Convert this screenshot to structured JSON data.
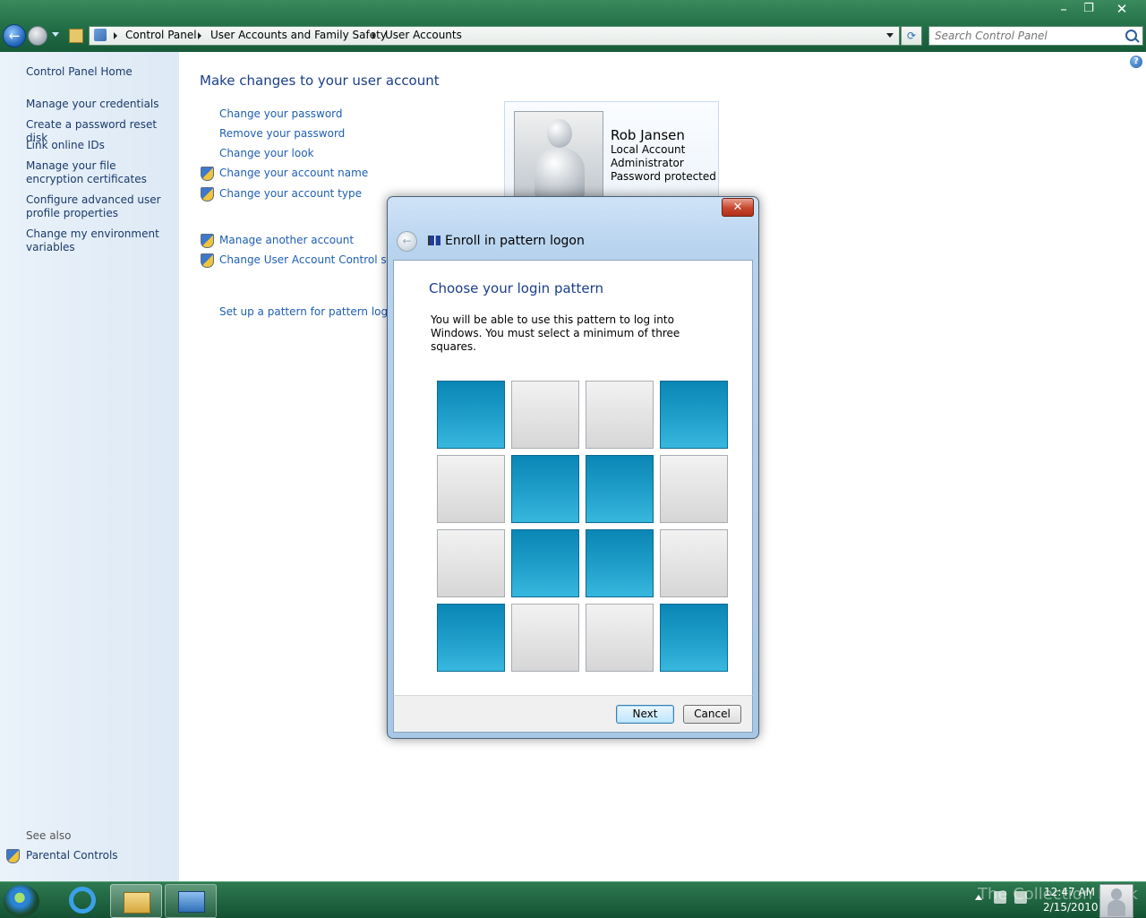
{
  "window": {
    "minimize_glyph": "–",
    "restore_glyph": "❐",
    "close_glyph": "✕"
  },
  "address_bar": {
    "breadcrumbs": [
      "Control Panel",
      "User Accounts and Family Safety",
      "User Accounts"
    ]
  },
  "search": {
    "placeholder": "Search Control Panel"
  },
  "sidebar": {
    "items": [
      {
        "label": "Control Panel Home"
      },
      {
        "label": "Manage your credentials"
      },
      {
        "label": "Create a password reset disk"
      },
      {
        "label": "Link online IDs"
      },
      {
        "label": "Manage your file encryption certificates"
      },
      {
        "label": "Configure advanced user profile properties"
      },
      {
        "label": "Change my environment variables"
      }
    ],
    "see_also_label": "See also",
    "see_also_items": [
      {
        "label": "Parental Controls",
        "icon": "uac-shield-icon"
      }
    ]
  },
  "main": {
    "title": "Make changes to your user account",
    "links": [
      {
        "label": "Change your password",
        "icon": ""
      },
      {
        "label": "Remove your password",
        "icon": ""
      },
      {
        "label": "Change your look",
        "icon": ""
      },
      {
        "label": "Change your account name",
        "icon": "uac-shield-icon"
      },
      {
        "label": "Change your account type",
        "icon": "uac-shield-icon"
      },
      {
        "label": "Manage another account",
        "icon": "uac-shield-icon"
      },
      {
        "label": "Change User Account Control settings",
        "icon": "uac-shield-icon"
      },
      {
        "label": "Set up a pattern for pattern logon",
        "icon": ""
      }
    ],
    "account": {
      "name": "Rob Jansen",
      "type": "Local Account",
      "role": "Administrator",
      "status": "Password protected"
    }
  },
  "dialog": {
    "title": "Enroll in pattern logon",
    "heading": "Choose your login pattern",
    "description": "You will be able to use this pattern to log into Windows. You must select a minimum of three squares.",
    "grid_selected": [
      [
        true,
        false,
        false,
        true
      ],
      [
        false,
        true,
        true,
        false
      ],
      [
        false,
        true,
        true,
        false
      ],
      [
        true,
        false,
        false,
        true
      ]
    ],
    "next_label": "Next",
    "cancel_label": "Cancel",
    "close_glyph": "✕",
    "back_glyph": "←"
  },
  "taskbar": {
    "clock_time": "12:47 AM",
    "clock_date": "2/15/2010",
    "watermark": "The Collection Book"
  },
  "colors": {
    "selected_square": "#1b9bc9",
    "unselected_square": "#e2e2e2",
    "link": "#1e5fb4",
    "titlebar": "#2a7a50"
  }
}
